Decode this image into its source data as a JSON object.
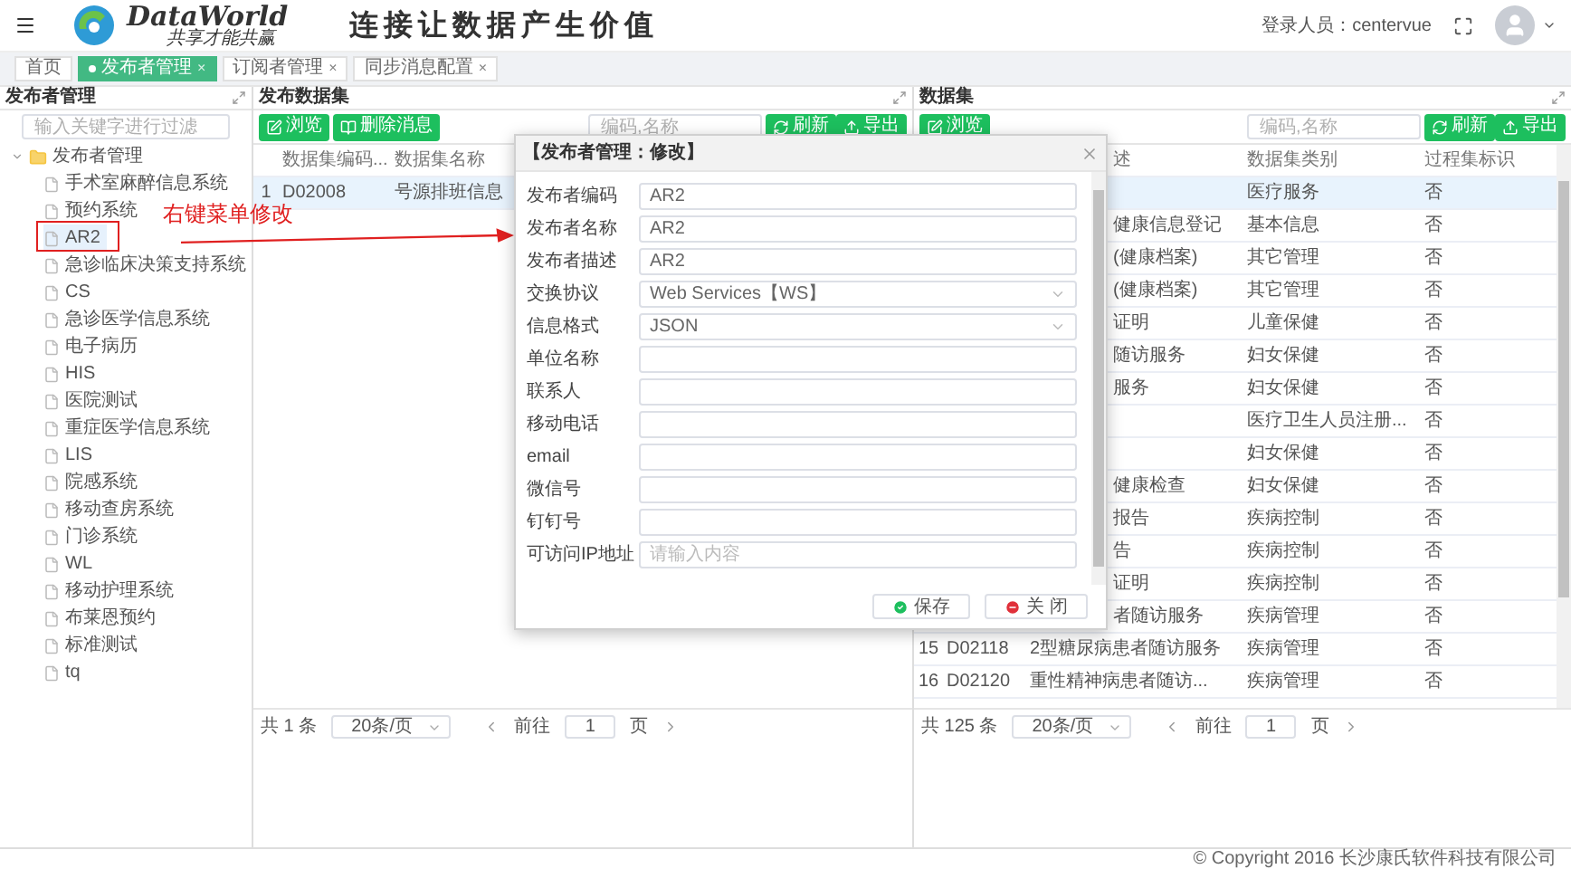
{
  "header": {
    "brand": "DataWorld",
    "tagline": "共享才能共赢",
    "slogan": "连接让数据产生价值",
    "user_label": "登录人员：centervue"
  },
  "tabs": [
    {
      "label": "首页",
      "selected": false
    },
    {
      "label": "发布者管理",
      "selected": true,
      "close": "×"
    },
    {
      "label": "订阅者管理",
      "selected": false,
      "close": "×"
    },
    {
      "label": "同步消息配置",
      "selected": false,
      "close": "×"
    }
  ],
  "left_panel": {
    "title": "发布者管理",
    "filter_placeholder": "输入关键字进行过滤",
    "tree": [
      {
        "label": "发布者管理",
        "expanded": true,
        "selected": false,
        "children": [
          {
            "label": "手术室麻醉信息系统",
            "selected": false
          },
          {
            "label": "预约系统",
            "selected": false
          },
          {
            "label": "AR2",
            "selected": true
          },
          {
            "label": "急诊临床决策支持系统",
            "selected": false
          },
          {
            "label": "CS",
            "selected": false
          },
          {
            "label": "急诊医学信息系统",
            "selected": false
          },
          {
            "label": "电子病历",
            "selected": false
          },
          {
            "label": "HIS",
            "selected": false
          },
          {
            "label": "医院测试",
            "selected": false
          },
          {
            "label": "重症医学信息系统",
            "selected": false
          },
          {
            "label": "LIS",
            "selected": false
          },
          {
            "label": "院感系统",
            "selected": false
          },
          {
            "label": "移动查房系统",
            "selected": false
          },
          {
            "label": "门诊系统",
            "selected": false
          },
          {
            "label": "WL",
            "selected": false
          },
          {
            "label": "移动护理系统",
            "selected": false
          },
          {
            "label": "布莱恩预约",
            "selected": false
          },
          {
            "label": "标准测试",
            "selected": false
          },
          {
            "label": "tq",
            "selected": false
          }
        ]
      }
    ]
  },
  "annotation": {
    "text": "右键菜单修改"
  },
  "middle_panel": {
    "title": "发布数据集",
    "buttons": [
      {
        "label": "浏览",
        "kind": "browse"
      },
      {
        "label": "删除消息",
        "kind": "delete"
      }
    ],
    "search_placeholder": "编码,名称",
    "actions": [
      {
        "label": "刷新",
        "kind": "refresh"
      },
      {
        "label": "导出",
        "kind": "export"
      }
    ],
    "columns": [
      "数据集编码...",
      "数据集名称"
    ],
    "rows": [
      {
        "index": "1",
        "code": "D02008",
        "name": "号源排班信息",
        "selected": true
      }
    ],
    "pagination": {
      "total": "共 1 条",
      "page_size": "20条/页",
      "goto": "前往",
      "page": "1",
      "page_unit": "页"
    }
  },
  "right_panel": {
    "title": "数据集",
    "buttons": [
      {
        "label": "浏览",
        "kind": "browse"
      }
    ],
    "search_placeholder": "编码,名称",
    "actions": [
      {
        "label": "刷新",
        "kind": "refresh"
      },
      {
        "label": "导出",
        "kind": "export"
      }
    ],
    "columns": [
      "述",
      "数据集类别",
      "过程集标识"
    ],
    "rows": [
      {
        "category": "医疗服务",
        "flag": "否",
        "selected": true
      },
      {
        "description": "健康信息登记",
        "category": "基本信息",
        "flag": "否",
        "selected": false
      },
      {
        "description": "(健康档案)",
        "category": "其它管理",
        "flag": "否",
        "selected": false
      },
      {
        "description": "(健康档案)",
        "category": "其它管理",
        "flag": "否",
        "selected": false
      },
      {
        "description": "证明",
        "category": "儿童保健",
        "flag": "否",
        "selected": false
      },
      {
        "description": "随访服务",
        "category": "妇女保健",
        "flag": "否",
        "selected": false
      },
      {
        "description": "服务",
        "category": "妇女保健",
        "flag": "否",
        "selected": false
      },
      {
        "category": "医疗卫生人员注册...",
        "flag": "否",
        "selected": false
      },
      {
        "category": "妇女保健",
        "flag": "否",
        "selected": false
      },
      {
        "description": "健康检查",
        "category": "妇女保健",
        "flag": "否",
        "selected": false
      },
      {
        "description": "报告",
        "category": "疾病控制",
        "flag": "否",
        "selected": false
      },
      {
        "description": "告",
        "category": "疾病控制",
        "flag": "否",
        "selected": false
      },
      {
        "description": "证明",
        "category": "疾病控制",
        "flag": "否",
        "selected": false
      },
      {
        "description": "者随访服务",
        "category": "疾病管理",
        "flag": "否",
        "selected": false
      },
      {
        "index": "15",
        "code": "D02118",
        "description": "2型糖尿病患者随访服务",
        "category": "疾病管理",
        "flag": "否",
        "selected": false
      },
      {
        "index": "16",
        "code": "D02120",
        "description": "重性精神病患者随访...",
        "category": "疾病管理",
        "flag": "否",
        "selected": false
      }
    ],
    "pagination": {
      "total": "共 125 条",
      "page_size": "20条/页",
      "goto": "前往",
      "page": "1",
      "page_unit": "页"
    }
  },
  "dialog": {
    "title": "【发布者管理：修改】",
    "fields": [
      {
        "label": "发布者编码",
        "kind": "text",
        "value": "AR2"
      },
      {
        "label": "发布者名称",
        "kind": "text",
        "value": "AR2"
      },
      {
        "label": "发布者描述",
        "kind": "text",
        "value": "AR2"
      },
      {
        "label": "交换协议",
        "kind": "select",
        "value": "Web Services【WS】"
      },
      {
        "label": "信息格式",
        "kind": "select",
        "value": "JSON"
      },
      {
        "label": "单位名称",
        "kind": "text"
      },
      {
        "label": "联系人",
        "kind": "text"
      },
      {
        "label": "移动电话",
        "kind": "text"
      },
      {
        "label": "email",
        "kind": "text"
      },
      {
        "label": "微信号",
        "kind": "text"
      },
      {
        "label": "钉钉号",
        "kind": "text"
      },
      {
        "label": "可访问IP地址",
        "kind": "text",
        "placeholder": "请输入内容"
      }
    ],
    "buttons": [
      {
        "label": "保存",
        "kind": "save"
      },
      {
        "label": "关 闭",
        "kind": "close"
      }
    ]
  },
  "footer": {
    "copyright": "© Copyright 2016 长沙康氏软件科技有限公司"
  }
}
